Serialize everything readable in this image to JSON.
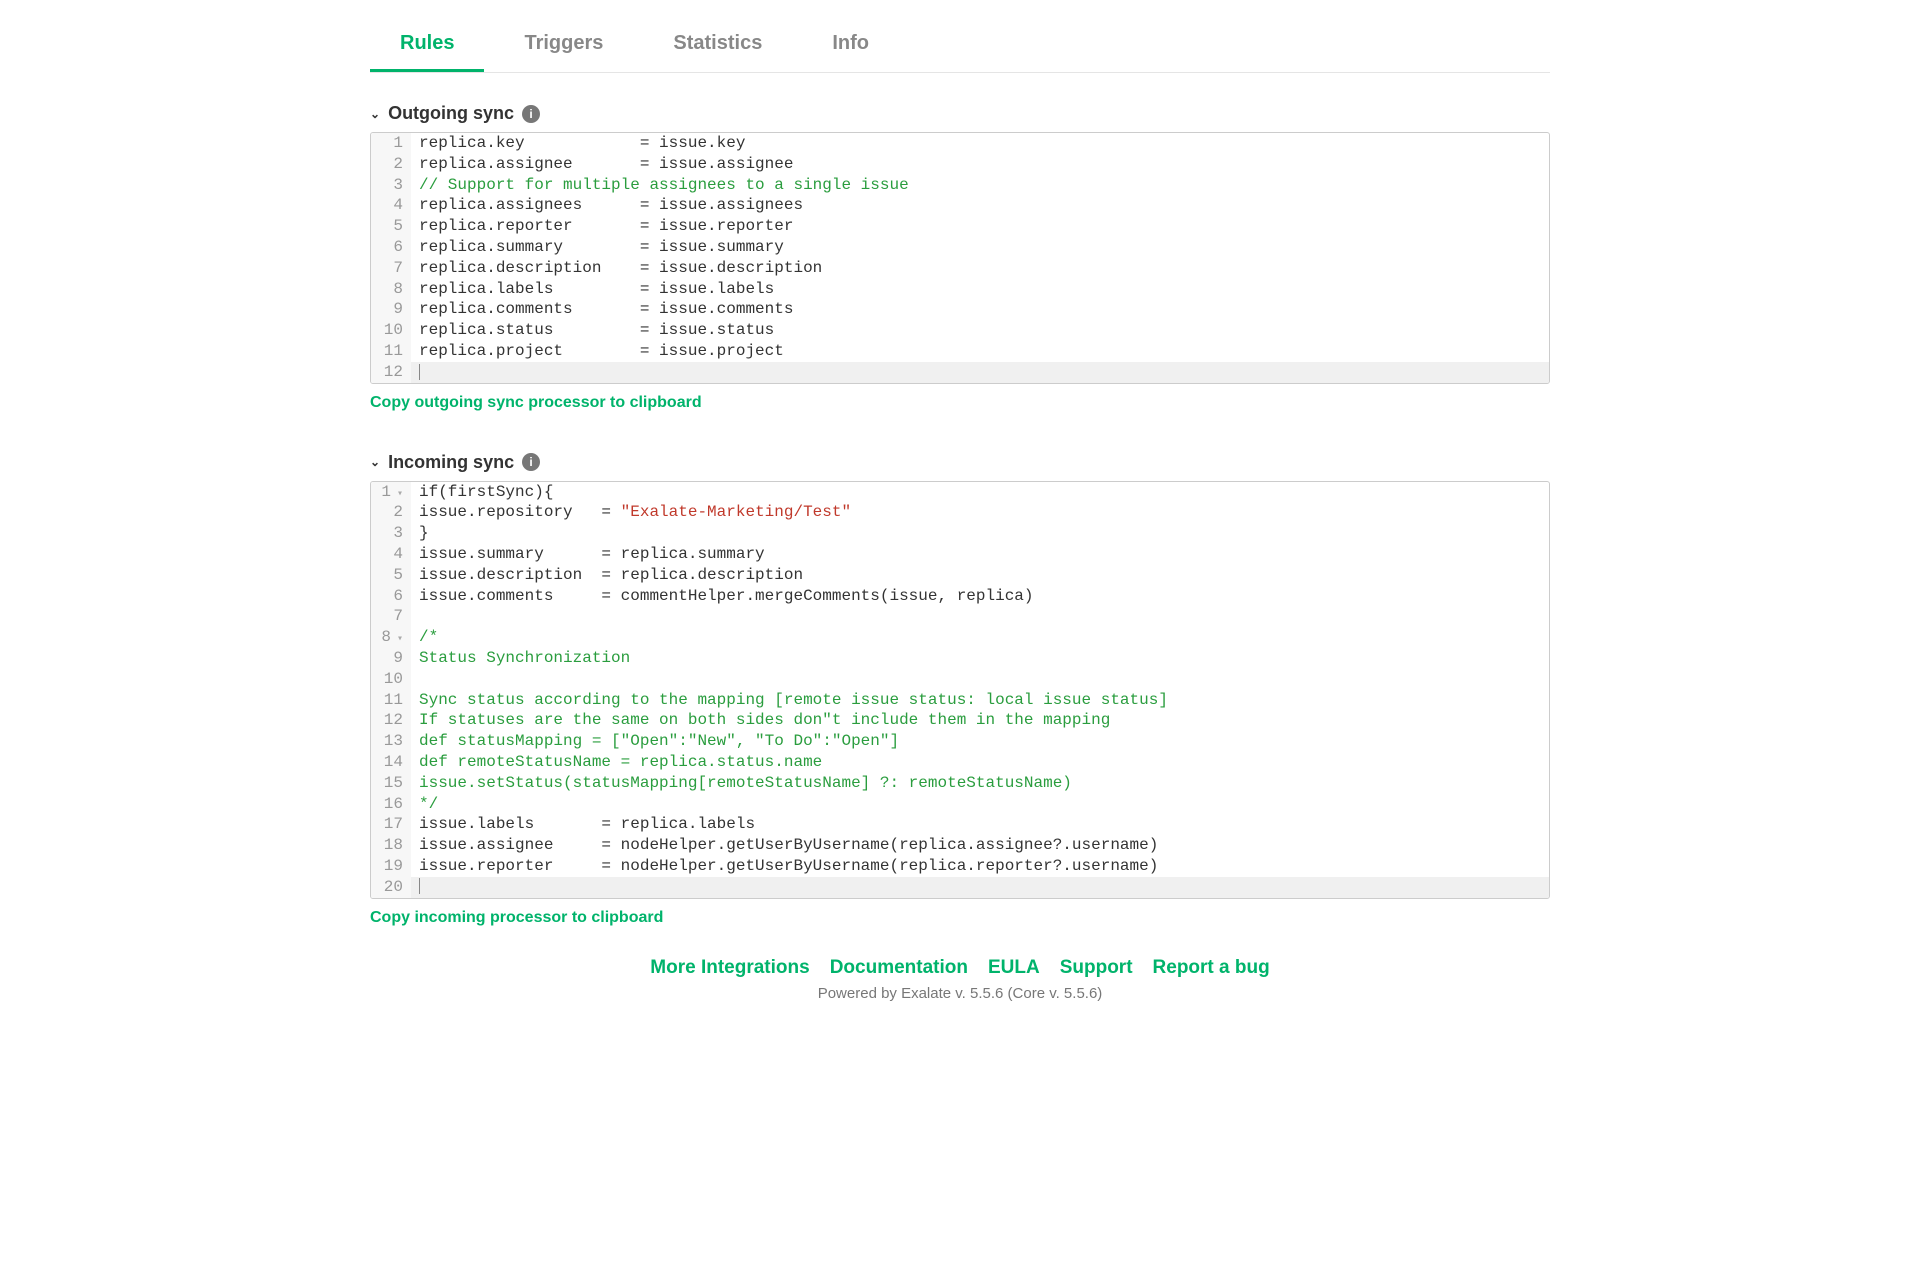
{
  "tabs": {
    "rules": "Rules",
    "triggers": "Triggers",
    "statistics": "Statistics",
    "info": "Info"
  },
  "section": {
    "outgoing_title": "Outgoing sync",
    "incoming_title": "Incoming sync"
  },
  "copy": {
    "outgoing": "Copy outgoing sync processor to clipboard",
    "incoming": "Copy incoming processor to clipboard"
  },
  "outgoing_lines": [
    {
      "n": "1",
      "text": "replica.key            = issue.key"
    },
    {
      "n": "2",
      "text": "replica.assignee       = issue.assignee"
    },
    {
      "n": "3",
      "text": "// Support for multiple assignees to a single issue",
      "cls": "tok-comment"
    },
    {
      "n": "4",
      "text": "replica.assignees      = issue.assignees"
    },
    {
      "n": "5",
      "text": "replica.reporter       = issue.reporter"
    },
    {
      "n": "6",
      "text": "replica.summary        = issue.summary"
    },
    {
      "n": "7",
      "text": "replica.description    = issue.description"
    },
    {
      "n": "8",
      "text": "replica.labels         = issue.labels"
    },
    {
      "n": "9",
      "text": "replica.comments       = issue.comments"
    },
    {
      "n": "10",
      "text": "replica.status         = issue.status"
    },
    {
      "n": "11",
      "text": "replica.project        = issue.project"
    },
    {
      "n": "12",
      "text": "",
      "empty": true
    }
  ],
  "incoming_lines": [
    {
      "n": "1",
      "fold": true,
      "segments": [
        {
          "t": "if(firstSync){"
        }
      ]
    },
    {
      "n": "2",
      "segments": [
        {
          "t": "issue.repository   = "
        },
        {
          "t": "\"Exalate-Marketing/Test\"",
          "cls": "tok-str"
        }
      ]
    },
    {
      "n": "3",
      "segments": [
        {
          "t": "}"
        }
      ]
    },
    {
      "n": "4",
      "segments": [
        {
          "t": "issue.summary      = replica.summary"
        }
      ]
    },
    {
      "n": "5",
      "segments": [
        {
          "t": "issue.description  = replica.description"
        }
      ]
    },
    {
      "n": "6",
      "segments": [
        {
          "t": "issue.comments     = commentHelper.mergeComments(issue, replica)"
        }
      ]
    },
    {
      "n": "7",
      "segments": [
        {
          "t": ""
        }
      ]
    },
    {
      "n": "8",
      "fold": true,
      "segments": [
        {
          "t": "/*",
          "cls": "tok-comment"
        }
      ]
    },
    {
      "n": "9",
      "segments": [
        {
          "t": "Status Synchronization",
          "cls": "tok-comment"
        }
      ]
    },
    {
      "n": "10",
      "segments": [
        {
          "t": "",
          "cls": "tok-comment"
        }
      ]
    },
    {
      "n": "11",
      "segments": [
        {
          "t": "Sync status according to the mapping [remote issue status: local issue status]",
          "cls": "tok-comment"
        }
      ]
    },
    {
      "n": "12",
      "segments": [
        {
          "t": "If statuses are the same on both sides don\"t include them in the mapping",
          "cls": "tok-comment"
        }
      ]
    },
    {
      "n": "13",
      "segments": [
        {
          "t": "def statusMapping = [\"Open\":\"New\", \"To Do\":\"Open\"]",
          "cls": "tok-comment"
        }
      ]
    },
    {
      "n": "14",
      "segments": [
        {
          "t": "def remoteStatusName = replica.status.name",
          "cls": "tok-comment"
        }
      ]
    },
    {
      "n": "15",
      "segments": [
        {
          "t": "issue.setStatus(statusMapping[remoteStatusName] ?: remoteStatusName)",
          "cls": "tok-comment"
        }
      ]
    },
    {
      "n": "16",
      "segments": [
        {
          "t": "*/",
          "cls": "tok-comment"
        }
      ]
    },
    {
      "n": "17",
      "segments": [
        {
          "t": "issue.labels       = replica.labels"
        }
      ]
    },
    {
      "n": "18",
      "segments": [
        {
          "t": "issue.assignee     = nodeHelper.getUserByUsername(replica.assignee?.username)"
        }
      ]
    },
    {
      "n": "19",
      "segments": [
        {
          "t": "issue.reporter     = nodeHelper.getUserByUsername(replica.reporter?.username)"
        }
      ]
    },
    {
      "n": "20",
      "segments": [
        {
          "t": ""
        }
      ],
      "empty": true
    }
  ],
  "footer": {
    "more": "More Integrations",
    "docs": "Documentation",
    "eula": "EULA",
    "support": "Support",
    "report": "Report a bug",
    "meta": "Powered by Exalate v. 5.5.6 (Core v. 5.5.6)"
  }
}
